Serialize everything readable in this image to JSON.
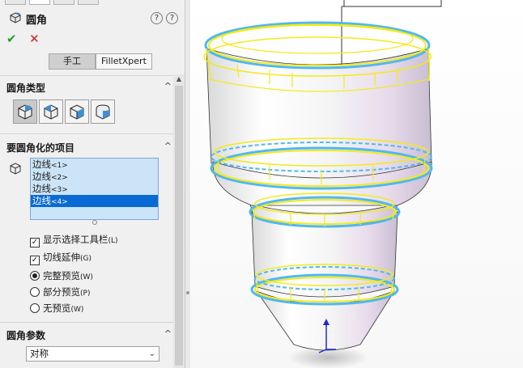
{
  "feature": {
    "title": "圆角",
    "help": "?",
    "help2": "?"
  },
  "actions": {
    "ok": "✔",
    "cancel": "✕"
  },
  "mode_tabs": [
    {
      "label": "手工",
      "active": true
    },
    {
      "label": "FilletXpert",
      "active": false
    }
  ],
  "sections": {
    "fillet_type": {
      "title": "圆角类型",
      "caret": "^"
    },
    "items_to_fillet": {
      "title": "要圆角化的项目",
      "caret": "^"
    },
    "fillet_params": {
      "title": "圆角参数",
      "caret": "^"
    }
  },
  "edges": [
    {
      "name": "边线",
      "tag": "<1>",
      "selected": false
    },
    {
      "name": "边线",
      "tag": "<2>",
      "selected": false
    },
    {
      "name": "边线",
      "tag": "<3>",
      "selected": false
    },
    {
      "name": "边线",
      "tag": "<4>",
      "selected": true
    }
  ],
  "options": {
    "show_toolbar": {
      "label": "显示选择工具栏",
      "key": "(L)",
      "checked": true
    },
    "tangent": {
      "label": "切线延伸",
      "key": "(G)",
      "checked": true
    },
    "full_preview": {
      "label": "完整预览",
      "key": "(W)",
      "selected": true
    },
    "partial_preview": {
      "label": "部分预览",
      "key": "(P)",
      "selected": false
    },
    "no_preview": {
      "label": "无预览",
      "key": "(W)",
      "selected": false
    }
  },
  "params": {
    "profile": "对称"
  },
  "colors": {
    "edge": "#f2ea1c",
    "highlight": "#4fb8f0",
    "selection": "#0a6ad4",
    "ok": "#2a9a22",
    "cancel": "#d02020"
  }
}
